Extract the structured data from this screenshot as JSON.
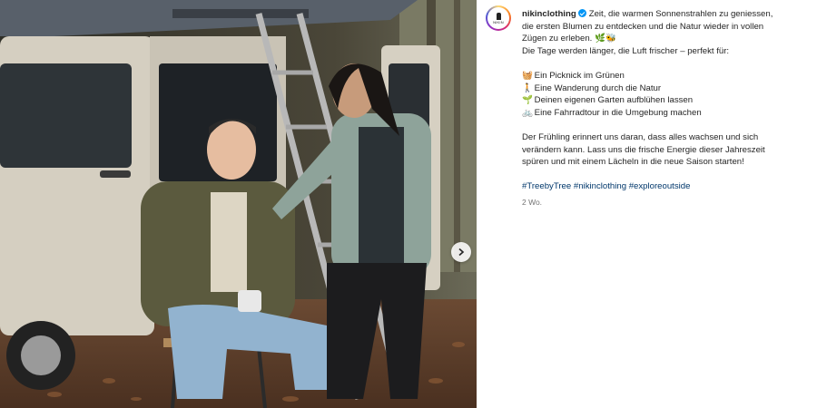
{
  "post": {
    "username": "nikinclothing",
    "avatar_brand": "NIKIN",
    "timestamp": "2 Wo.",
    "caption_lines": [
      "Zeit, die warmen Sonnenstrahlen zu geniessen,",
      "die ersten Blumen zu entdecken und die Natur wieder in vollen",
      "Zügen zu erleben. 🌿🐝"
    ],
    "intro": "Die Tage werden länger, die Luft frischer – perfekt für:",
    "activities": [
      {
        "icon": "🧺",
        "text": "Ein Picknick im Grünen"
      },
      {
        "icon": "🚶",
        "text": "Eine Wanderung durch die Natur"
      },
      {
        "icon": "🌱",
        "text": "Deinen eigenen Garten aufblühen lassen"
      },
      {
        "icon": "🚲",
        "text": "Eine Fahrradtour in die Umgebung machen"
      }
    ],
    "closing_lines": [
      "Der Frühling erinnert uns daran, dass alles wachsen und sich",
      "verändern kann. Lass uns die frische Energie dieser Jahreszeit",
      "spüren und mit einem Lächeln in die neue Saison starten!"
    ],
    "hashtags": [
      "#TreebyTree",
      "#nikinclothing",
      "#exploreoutside"
    ]
  },
  "colors": {
    "link": "#00376b",
    "verified": "#0095f6",
    "muted": "#737373"
  },
  "icons": {
    "verified": "verified-badge-icon",
    "next": "chevron-right-icon"
  }
}
